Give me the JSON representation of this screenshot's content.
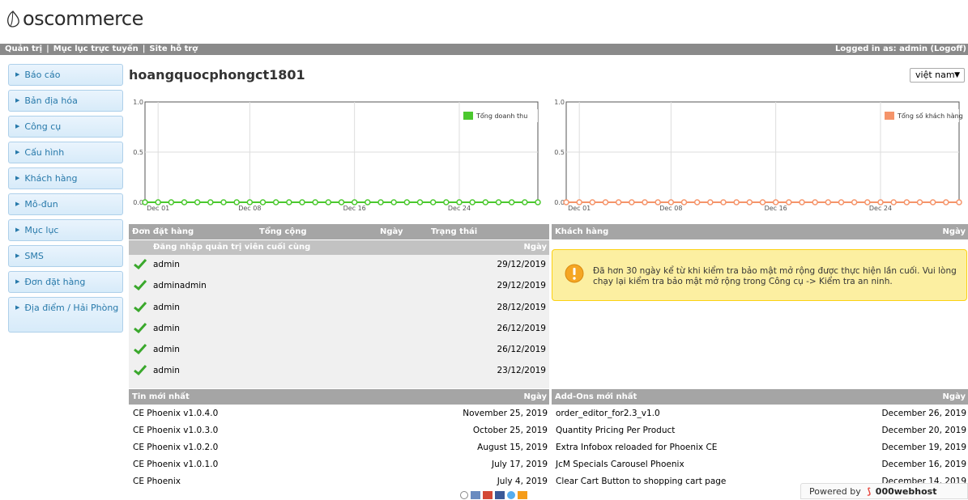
{
  "logo": {
    "text": "oscommerce"
  },
  "topbar": {
    "links": [
      "Quản trị",
      "Mục lục trực tuyến",
      "Site hỗ trợ"
    ],
    "logged_in": "Logged in as: admin (Logoff)"
  },
  "sidebar": {
    "items": [
      {
        "label": "Báo cáo"
      },
      {
        "label": "Bản địa hóa"
      },
      {
        "label": "Công cụ"
      },
      {
        "label": "Cấu hình"
      },
      {
        "label": "Khách hàng"
      },
      {
        "label": "Mô-đun"
      },
      {
        "label": "Mục lục"
      },
      {
        "label": "SMS"
      },
      {
        "label": "Đơn đặt hàng"
      },
      {
        "label": "Địa điểm / Hải Phòng"
      }
    ]
  },
  "page": {
    "title": "hoangquocphongct1801",
    "language": "việt nam"
  },
  "chart_data": [
    {
      "type": "line",
      "title": "",
      "x": [
        "Nov 30",
        "Dec 01",
        "Dec 02",
        "Dec 03",
        "Dec 04",
        "Dec 05",
        "Dec 06",
        "Dec 07",
        "Dec 08",
        "Dec 09",
        "Dec 10",
        "Dec 11",
        "Dec 12",
        "Dec 13",
        "Dec 14",
        "Dec 15",
        "Dec 16",
        "Dec 17",
        "Dec 18",
        "Dec 19",
        "Dec 20",
        "Dec 21",
        "Dec 22",
        "Dec 23",
        "Dec 24",
        "Dec 25",
        "Dec 26",
        "Dec 27",
        "Dec 28",
        "Dec 29",
        "Dec 30"
      ],
      "xticks": [
        "Dec 01",
        "Dec 08",
        "Dec 16",
        "Dec 24"
      ],
      "yticks": [
        "0.0",
        "0.5",
        "1.0"
      ],
      "ylim": [
        0,
        1
      ],
      "series": [
        {
          "name": "Tổng doanh thu",
          "color": "#4bc82e",
          "values": [
            0,
            0,
            0,
            0,
            0,
            0,
            0,
            0,
            0,
            0,
            0,
            0,
            0,
            0,
            0,
            0,
            0,
            0,
            0,
            0,
            0,
            0,
            0,
            0,
            0,
            0,
            0,
            0,
            0,
            0,
            0
          ]
        }
      ],
      "legend": "top-right",
      "grid": true
    },
    {
      "type": "line",
      "title": "",
      "x": [
        "Nov 30",
        "Dec 01",
        "Dec 02",
        "Dec 03",
        "Dec 04",
        "Dec 05",
        "Dec 06",
        "Dec 07",
        "Dec 08",
        "Dec 09",
        "Dec 10",
        "Dec 11",
        "Dec 12",
        "Dec 13",
        "Dec 14",
        "Dec 15",
        "Dec 16",
        "Dec 17",
        "Dec 18",
        "Dec 19",
        "Dec 20",
        "Dec 21",
        "Dec 22",
        "Dec 23",
        "Dec 24",
        "Dec 25",
        "Dec 26",
        "Dec 27",
        "Dec 28",
        "Dec 29",
        "Dec 30"
      ],
      "xticks": [
        "Dec 01",
        "Dec 08",
        "Dec 16",
        "Dec 24"
      ],
      "yticks": [
        "0.0",
        "0.5",
        "1.0"
      ],
      "ylim": [
        0,
        1
      ],
      "series": [
        {
          "name": "Tổng số khách hàng",
          "color": "#f5946a",
          "values": [
            0,
            0,
            0,
            0,
            0,
            0,
            0,
            0,
            0,
            0,
            0,
            0,
            0,
            0,
            0,
            0,
            0,
            0,
            0,
            0,
            0,
            0,
            0,
            0,
            0,
            0,
            0,
            0,
            0,
            0,
            0
          ]
        }
      ],
      "legend": "top-right",
      "grid": true
    }
  ],
  "orders": {
    "columns": [
      "Đơn đặt hàng",
      "Tổng cộng",
      "Ngày",
      "Trạng thái"
    ]
  },
  "customers": {
    "columns": [
      "Khách hàng",
      "Ngày"
    ]
  },
  "admin_logins": {
    "title": "Đăng nhập quản trị viên cuối cùng",
    "date_label": "Ngày",
    "rows": [
      {
        "name": "admin",
        "date": "29/12/2019"
      },
      {
        "name": "adminadmin",
        "date": "29/12/2019"
      },
      {
        "name": "admin",
        "date": "28/12/2019"
      },
      {
        "name": "admin",
        "date": "26/12/2019"
      },
      {
        "name": "admin",
        "date": "26/12/2019"
      },
      {
        "name": "admin",
        "date": "23/12/2019"
      }
    ]
  },
  "security_warning": {
    "text": "Đã hơn 30 ngày kể từ khi kiểm tra bảo mật mở rộng được thực hiện lần cuối. Vui lòng chạy lại kiểm tra bảo mật mở rộng trong Công cụ -> Kiểm tra an ninh."
  },
  "news": {
    "title": "Tin mới nhất",
    "date_label": "Ngày",
    "rows": [
      {
        "title": "CE Phoenix v1.0.4.0",
        "date": "November 25, 2019"
      },
      {
        "title": "CE Phoenix v1.0.3.0",
        "date": "October 25, 2019"
      },
      {
        "title": "CE Phoenix v1.0.2.0",
        "date": "August 15, 2019"
      },
      {
        "title": "CE Phoenix v1.0.1.0",
        "date": "July 17, 2019"
      },
      {
        "title": "CE Phoenix",
        "date": "July 4, 2019"
      }
    ]
  },
  "addons": {
    "title": "Add-Ons mới nhất",
    "date_label": "Ngày",
    "rows": [
      {
        "title": "order_editor_for2.3_v1.0",
        "date": "December 26, 2019"
      },
      {
        "title": "Quantity Pricing Per Product",
        "date": "December 20, 2019"
      },
      {
        "title": "Extra Infobox reloaded for Phoenix CE",
        "date": "December 19, 2019"
      },
      {
        "title": "JcM Specials Carousel Phoenix",
        "date": "December 16, 2019"
      },
      {
        "title": "Clear Cart Button to shopping cart page",
        "date": "December 14, 2019"
      }
    ]
  },
  "powered": {
    "text": "Powered by",
    "brand": "000webhost"
  }
}
